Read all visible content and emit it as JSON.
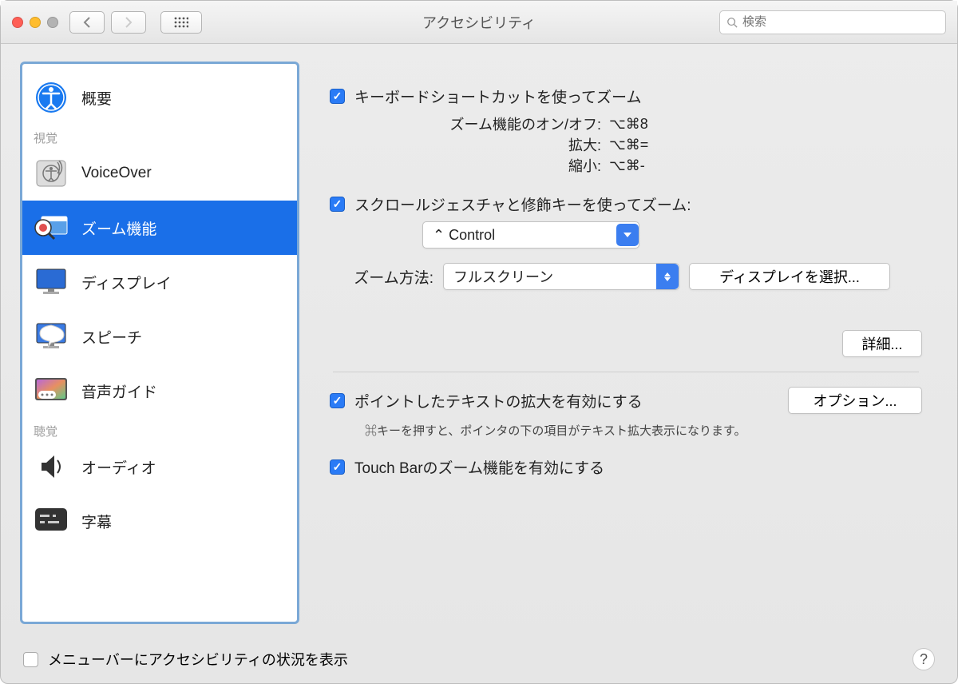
{
  "window": {
    "title": "アクセシビリティ",
    "search_placeholder": "検索"
  },
  "sidebar": {
    "items": [
      {
        "label": "概要"
      }
    ],
    "section_vision": "視覚",
    "vision_items": [
      {
        "label": "VoiceOver"
      },
      {
        "label": "ズーム機能"
      },
      {
        "label": "ディスプレイ"
      },
      {
        "label": "スピーチ"
      },
      {
        "label": "音声ガイド"
      }
    ],
    "section_hearing": "聴覚",
    "hearing_items": [
      {
        "label": "オーディオ"
      },
      {
        "label": "字幕"
      }
    ]
  },
  "pane": {
    "keyboard_zoom": "キーボードショートカットを使ってズーム",
    "shortcuts": {
      "toggle_label": "ズーム機能のオン/オフ:",
      "toggle_keys": "⌥⌘8",
      "zoom_in_label": "拡大:",
      "zoom_in_keys": "⌥⌘=",
      "zoom_out_label": "縮小:",
      "zoom_out_keys": "⌥⌘-"
    },
    "scroll_zoom": "スクロールジェスチャと修飾キーを使ってズーム:",
    "scroll_modifier": "⌃ Control",
    "method_label": "ズーム方法:",
    "method_value": "フルスクリーン",
    "choose_display": "ディスプレイを選択...",
    "advanced": "詳細...",
    "hover_text": "ポイントしたテキストの拡大を有効にする",
    "hover_options": "オプション...",
    "hover_help": "⌘キーを押すと、ポインタの下の項目がテキスト拡大表示になります。",
    "touchbar_zoom": "Touch Barのズーム機能を有効にする"
  },
  "footer": {
    "show_status": "メニューバーにアクセシビリティの状況を表示",
    "help": "?"
  }
}
